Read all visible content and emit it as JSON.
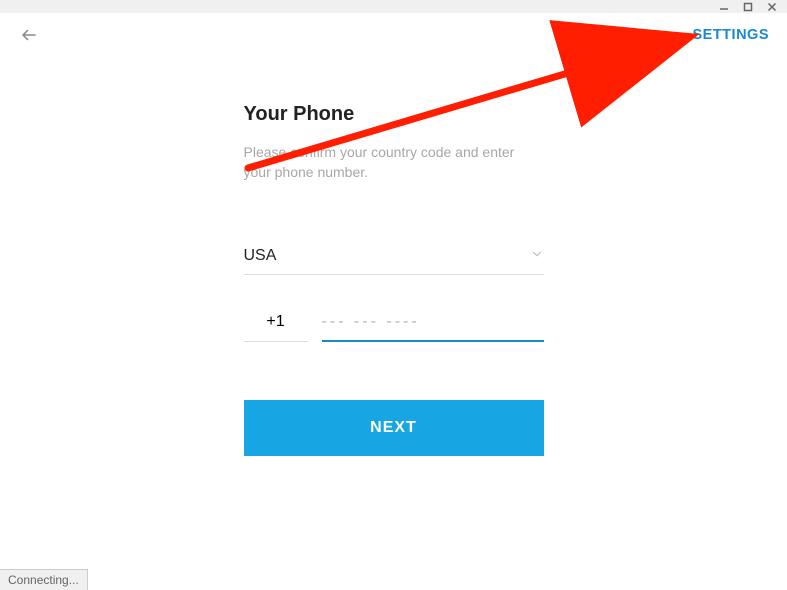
{
  "header": {
    "settings_label": "SETTINGS"
  },
  "form": {
    "title": "Your Phone",
    "subtitle": "Please confirm your country code and enter your phone number.",
    "country": "USA",
    "country_code": "+1",
    "phone_placeholder": "--- --- ----",
    "next_label": "NEXT"
  },
  "status": {
    "text": "Connecting..."
  },
  "colors": {
    "accent": "#168acd",
    "button": "#17a6e3",
    "arrow": "#ff1e00"
  }
}
